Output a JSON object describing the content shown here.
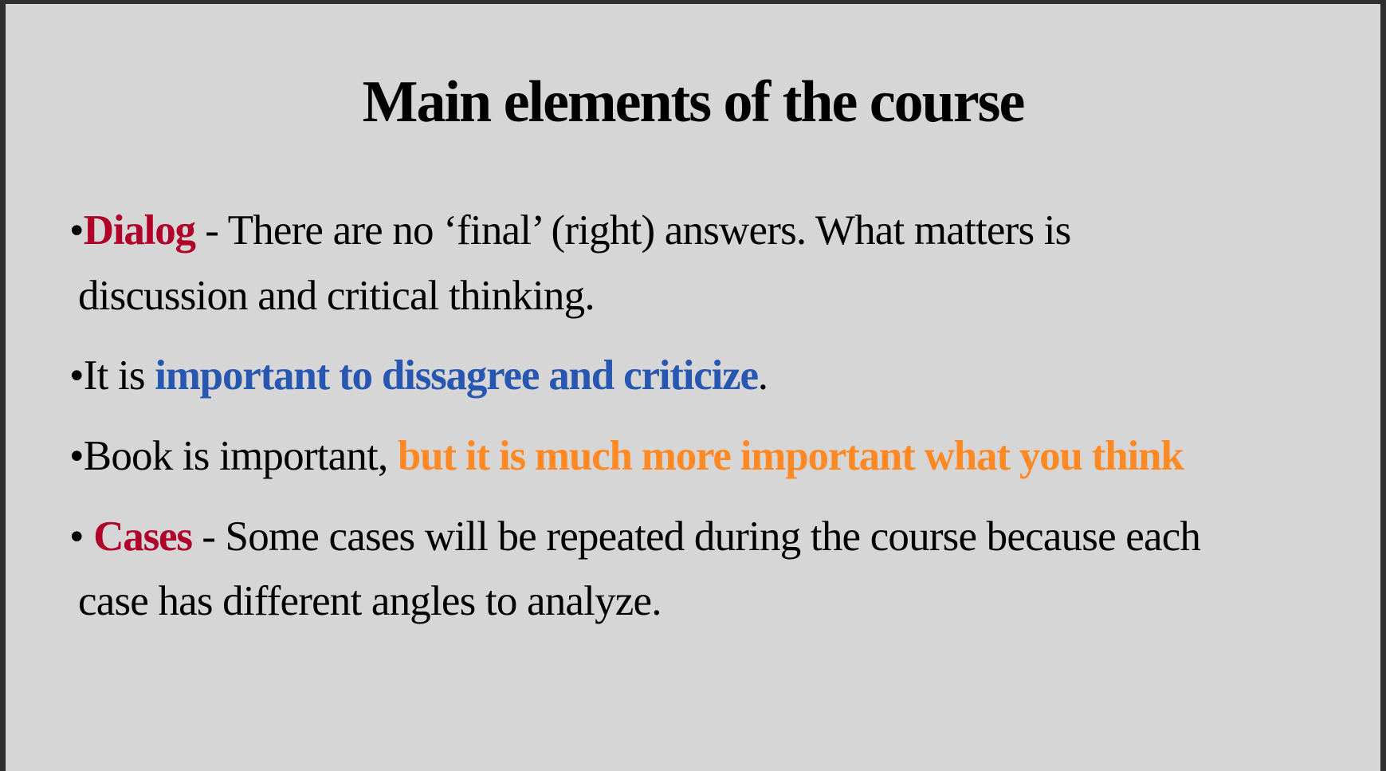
{
  "title": "Main elements of the course",
  "colors": {
    "red": "#b0002a",
    "blue": "#2757b0",
    "orange": "#ff8a25"
  },
  "bullets": [
    {
      "bullet": "•",
      "highlight": "Dialog",
      "text": " - There are no ‘final’ (right) answers. What matters is",
      "continuation": "discussion and critical thinking."
    },
    {
      "bullet": "•",
      "prefix": "It is ",
      "highlight": "important to dissagree and criticize",
      "suffix": "."
    },
    {
      "bullet": "•",
      "prefix": "Book is important, ",
      "highlight": "but it is much more important what you think"
    },
    {
      "bullet": "• ",
      "highlight": "Cases",
      "text": " - Some cases will be repeated during the course because each",
      "continuation": "case has different angles to analyze."
    }
  ]
}
